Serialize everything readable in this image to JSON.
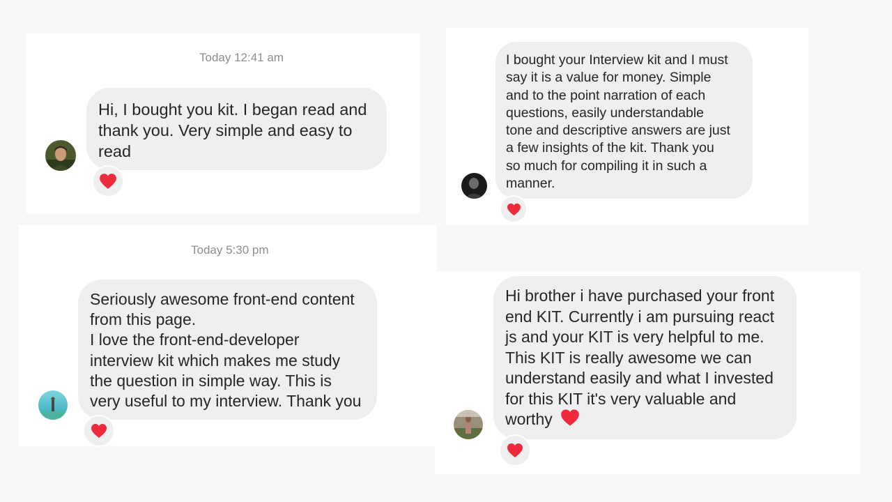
{
  "conversations": [
    {
      "timestamp": "Today 12:41 am",
      "message": "Hi, I bought you kit. I began read and\nthank you. Very simple and easy to\nread",
      "reaction": "heart-icon"
    },
    {
      "timestamp": "",
      "message": "I bought your Interview kit and I must\nsay it is a value for money. Simple\nand to the point narration of each\nquestions, easily understandable\ntone and descriptive answers are just\na few insights of the kit.  Thank you\nso much for compiling it in such a\nmanner.",
      "reaction": "heart-icon"
    },
    {
      "timestamp": "Today 5:30 pm",
      "message": "Seriously awesome front-end content\nfrom this page.\nI love the front-end-developer\ninterview kit which makes me study\nthe question in simple way. This is\nvery useful to my interview. Thank you",
      "reaction": "heart-icon"
    },
    {
      "timestamp": "",
      "message": "Hi brother i have purchased your front\nend KIT. Currently i am pursuing react\njs and your KIT is very helpful to me.\nThis KIT is really awesome we can\nunderstand easily and what I invested\nfor this KIT it's very valuable and\nworthy",
      "reaction": "heart-icon"
    }
  ],
  "colors": {
    "bubble": "#efefef",
    "text": "#262626",
    "timestamp": "#8e8e8e",
    "heart": "#ed2b3d"
  }
}
